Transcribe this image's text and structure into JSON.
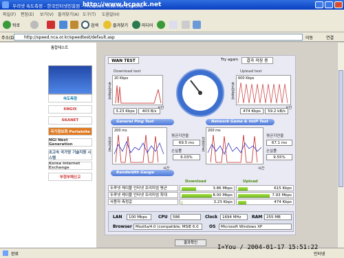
{
  "window": {
    "title": "우리넷 속도측정 - 한국인터넷진흥원 - Microsoft Internet Explorer",
    "watermark": "http://www.bcpark.net"
  },
  "menu": [
    "파일(F)",
    "편집(E)",
    "보기(V)",
    "즐겨찾기(A)",
    "도구(T)",
    "도움말(H)"
  ],
  "toolbar": {
    "back": "뒤로",
    "search": "검색",
    "favorites": "즐겨찾기",
    "media": "미디어"
  },
  "address": {
    "label": "주소(D)",
    "url": "http://speed.nca.or.kr/speedtest/default.asp",
    "go": "이동",
    "links": "연결"
  },
  "sidebar": {
    "title": "통합테스트",
    "items": [
      "속도측정",
      "6NGIX",
      "6KANET",
      "국가정보화 Portalsite",
      "NGI Next Generation",
      "초고속 국가망 기술지원 시스템",
      "Korea Internet Exchange",
      "부정부패신고"
    ]
  },
  "panel": {
    "tab": "WAN TEST",
    "try_again": "Try again",
    "save": "결과 저장 중",
    "download": {
      "label": "Download test",
      "kbps": "3.23 Kbps",
      "bps": "403 B/s",
      "axis_top": "20 Kbps",
      "axis_y": "속도(kbps)",
      "axis_x": "시간"
    },
    "upload": {
      "label": "Upload test",
      "kbps": "474 Kbps",
      "bps": "59.2 kB/s",
      "axis_top": "600 Kbps",
      "axis_y": "속도(kbps)",
      "axis_x": "시간"
    },
    "ping": {
      "label": "General Ping Test",
      "axis_top": "200 ms",
      "axis_y": "지연(ms)",
      "axis_x": "시간",
      "avg_label": "평균지연율",
      "avg": "69.5 ms",
      "loss_label": "손실률",
      "loss": "6.03%"
    },
    "voip": {
      "label": "Network Game & VoIP Test",
      "axis_top": "200 ms",
      "axis_y": "지연(ms)",
      "axis_x": "시간",
      "avg_label": "평균지연율",
      "avg": "67.1 ms",
      "loss_label": "손실률",
      "loss": "9.55%"
    },
    "gauge": {
      "label": "Bandwidth Gauge",
      "down_label": "Download",
      "up_label": "Upload",
      "rows": [
        {
          "name": "두루넷 케이블 인터넷 프리미엄 평균",
          "down": "3.86 Mbps",
          "up": "615 Kbps",
          "down_frac": 0.48,
          "up_frac": 0.3
        },
        {
          "name": "두루넷 케이블 인터넷 프리미엄 최대",
          "down": "8.00 Mbps",
          "up": "7.93 Mbps",
          "down_frac": 1.0,
          "up_frac": 1.0
        },
        {
          "name": "사용자 측정값",
          "down": "3.23 Kbps",
          "up": "474 Kbps",
          "down_frac": 0.02,
          "up_frac": 0.25
        }
      ]
    },
    "info": {
      "lan_label": "LAN",
      "lan": "100 Mbps",
      "cpu_label": "CPU",
      "cpu": "586",
      "clock_label": "Clock",
      "clock": "1694 MHz",
      "ram_label": "RAM",
      "ram": "255 MB",
      "browser_label": "Browser",
      "browser": "Mozilla/4.0 (compatible; MSIE 6.0",
      "os_label": "OS",
      "os": "Microsoft Windows XP"
    },
    "confirm": "결과확인"
  },
  "status": {
    "left": "완료",
    "right": "인터넷",
    "stamp": "I∝You / 2004-01-17 15:51:22"
  },
  "colors": {
    "accent": "#4e79d8",
    "bar": "#6cb81c",
    "dl_graph": "#d04848",
    "series_blue": "#3030c0",
    "series_red": "#c02020"
  }
}
